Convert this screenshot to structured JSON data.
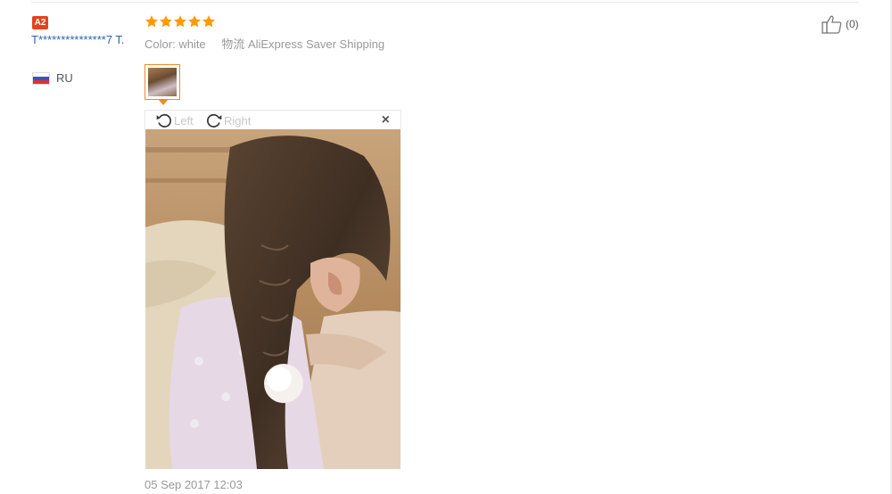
{
  "reviewer": {
    "badge": "A2",
    "name": "T***************7 T.",
    "country_code": "RU"
  },
  "review": {
    "rating": 5,
    "color_label": "Color:",
    "color_value": "white",
    "shipping_label": "物流",
    "shipping_value": "AliExpress Saver Shipping",
    "date": "05 Sep 2017 12:03"
  },
  "viewer": {
    "rotate_left_label": "Left",
    "rotate_right_label": "Right",
    "close_symbol": "×"
  },
  "like": {
    "count": "(0)"
  },
  "colors": {
    "star": "#ff9a00",
    "username": "#2a64b5",
    "badge": "#e8421c",
    "thumb_border": "#f08a24"
  },
  "icons": [
    "star-icon",
    "rotate-left-icon",
    "rotate-right-icon",
    "close-icon",
    "thumbs-up-icon",
    "russia-flag-icon"
  ]
}
